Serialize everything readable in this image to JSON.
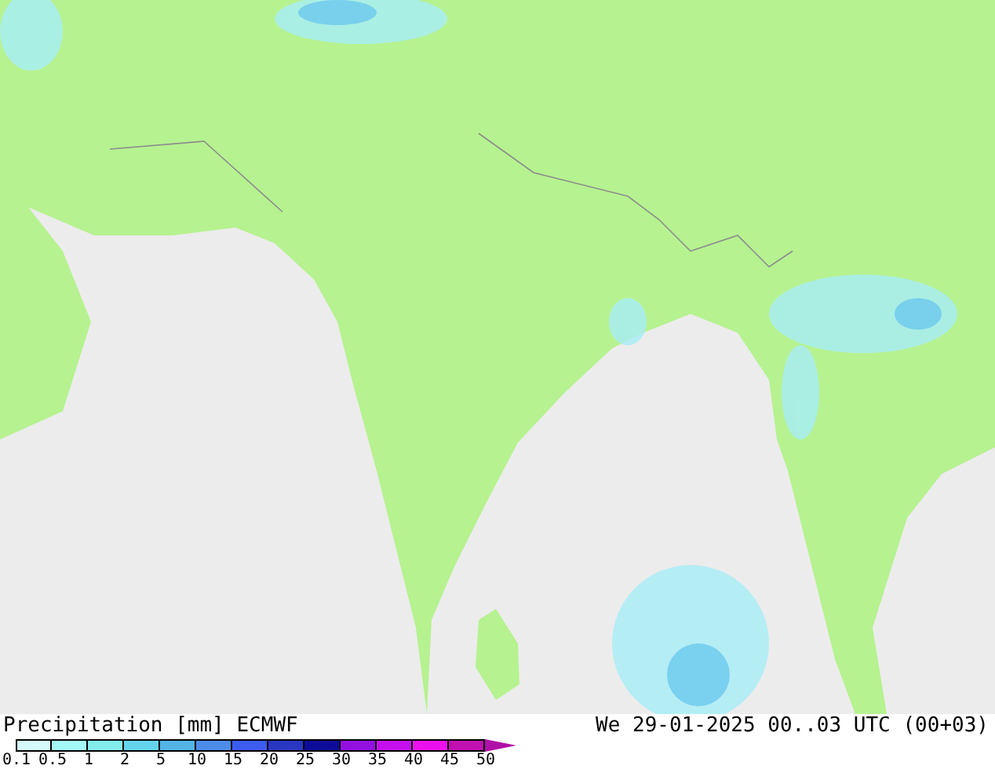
{
  "legend": {
    "title": "Precipitation [mm]",
    "model": "ECMWF",
    "valid_time": "We 29-01-2025 00..03 UTC (00+03)",
    "bins": [
      {
        "color": "#d4fafa"
      },
      {
        "color": "#a4f8f8"
      },
      {
        "color": "#84ecea"
      },
      {
        "color": "#64d4ec"
      },
      {
        "color": "#54b4e8"
      },
      {
        "color": "#4c8ce8"
      },
      {
        "color": "#3c5cf0"
      },
      {
        "color": "#2838c0"
      },
      {
        "color": "#0c0c98"
      },
      {
        "color": "#9410e0"
      },
      {
        "color": "#c410ec"
      },
      {
        "color": "#ec10ec"
      },
      {
        "color": "#c010b0"
      }
    ],
    "labels": [
      "0.1",
      "0.5",
      "1",
      "2",
      "5",
      "10",
      "15",
      "20",
      "25",
      "30",
      "35",
      "40",
      "45",
      "50"
    ]
  }
}
